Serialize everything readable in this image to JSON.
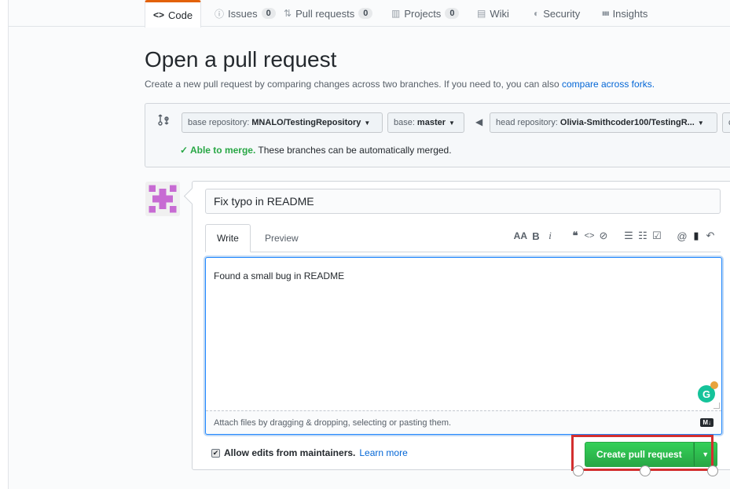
{
  "tabs": [
    {
      "label": "Code",
      "icon": "code-icon",
      "glyph": "<>",
      "selected": true
    },
    {
      "label": "Issues",
      "icon": "issue-icon",
      "glyph": "ⓘ",
      "count": "0"
    },
    {
      "label": "Pull requests",
      "icon": "pull-request-icon",
      "glyph": "⇅",
      "count": "0"
    },
    {
      "label": "Projects",
      "icon": "project-icon",
      "glyph": "▥",
      "count": "0"
    },
    {
      "label": "Wiki",
      "icon": "book-icon",
      "glyph": "▤"
    },
    {
      "label": "Security",
      "icon": "shield-icon",
      "glyph": "◐"
    },
    {
      "label": "Insights",
      "icon": "graph-icon",
      "glyph": "▮▮▮"
    }
  ],
  "page": {
    "title": "Open a pull request",
    "subtitle": "Create a new pull request by comparing changes across two branches. If you need to, you can also",
    "subtitle_link": "compare across forks."
  },
  "range": {
    "base_repo_label": "base repository:",
    "base_repo_value": "MNALO/TestingRepository",
    "base_label": "base:",
    "base_value": "master",
    "head_repo_label": "head repository:",
    "head_repo_value": "Olivia-Smithcoder100/TestingR...",
    "compare_partial": "c",
    "merge_ok": "✓ Able to merge.",
    "merge_text": "These branches can be automatically merged."
  },
  "form": {
    "title_value": "Fix typo in README",
    "tab_write": "Write",
    "tab_preview": "Preview",
    "toolbar": [
      "AA",
      "B",
      "i",
      "❝",
      "<>",
      "⊘",
      "☰",
      "☷",
      "☑",
      "@",
      "▮",
      "↶"
    ],
    "body_value": "Found a small bug in README",
    "attach_text": "Attach files by dragging & dropping, selecting or pasting them.",
    "markdown_badge": "M↓",
    "maintainers_check": "✔",
    "maintainers_label": "Allow edits from maintainers.",
    "learn_more": "Learn more",
    "create_button": "Create pull request",
    "create_caret": "▼"
  },
  "colors": {
    "accent_tab": "#e36209",
    "primary_green": "#28a745",
    "link_blue": "#0366d6",
    "annotation_red": "#d32f2f"
  }
}
